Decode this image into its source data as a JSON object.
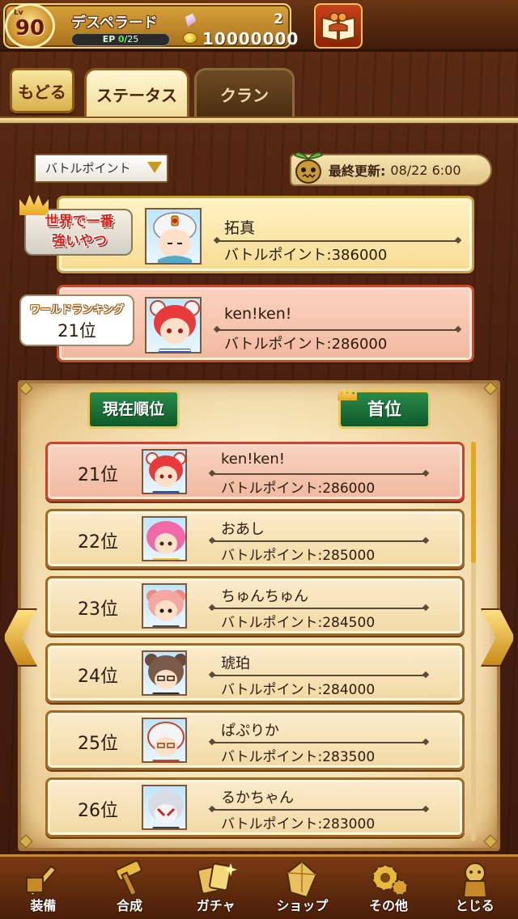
{
  "player": {
    "level_prefix": "Lv",
    "level": "90",
    "name": "デスペラード",
    "ep_label": "EP",
    "ep_current": "0",
    "ep_max": "/25",
    "gems": "2",
    "coins": "10000000"
  },
  "tabs": {
    "back_label": "もどる",
    "status_label": "ステータス",
    "clan_label": "クラン"
  },
  "filter": {
    "selected": "バトルポイント"
  },
  "update": {
    "label": "最終更新:",
    "value": "08/22 6:00"
  },
  "world_best": {
    "badge_line1": "世界で一番",
    "badge_line2": "強いやつ",
    "name": "拓真",
    "bp": "バトルポイント:386000"
  },
  "my_rank": {
    "badge_label": "ワールドランキング",
    "badge_rank": "21位",
    "name": "ken!ken!",
    "bp": "バトルポイント:286000"
  },
  "list_buttons": {
    "current": "現在順位",
    "first": "首位"
  },
  "rankings": [
    {
      "rank": "21位",
      "name": "ken!ken!",
      "bp": "バトルポイント:286000",
      "self": true
    },
    {
      "rank": "22位",
      "name": "おあし",
      "bp": "バトルポイント:285000",
      "self": false
    },
    {
      "rank": "23位",
      "name": "ちゅんちゅん",
      "bp": "バトルポイント:284500",
      "self": false
    },
    {
      "rank": "24位",
      "name": "琥珀",
      "bp": "バトルポイント:284000",
      "self": false
    },
    {
      "rank": "25位",
      "name": "ぱぷりか",
      "bp": "バトルポイント:283500",
      "self": false
    },
    {
      "rank": "26位",
      "name": "るかちゃん",
      "bp": "バトルポイント:283000",
      "self": false
    }
  ],
  "nav": [
    {
      "label": "装備",
      "icon": "equipment-icon"
    },
    {
      "label": "合成",
      "icon": "hammer-icon"
    },
    {
      "label": "ガチャ",
      "icon": "gacha-cards-icon"
    },
    {
      "label": "ショップ",
      "icon": "shop-crystal-icon"
    },
    {
      "label": "その他",
      "icon": "gear-icon"
    },
    {
      "label": "とじる",
      "icon": "close-statue-icon"
    }
  ],
  "colors": {
    "accent_gold": "#e8c860",
    "self_row": "#f2b8a0",
    "normal_row": "#f2d9a4",
    "button_green": "#1a6e3a"
  }
}
